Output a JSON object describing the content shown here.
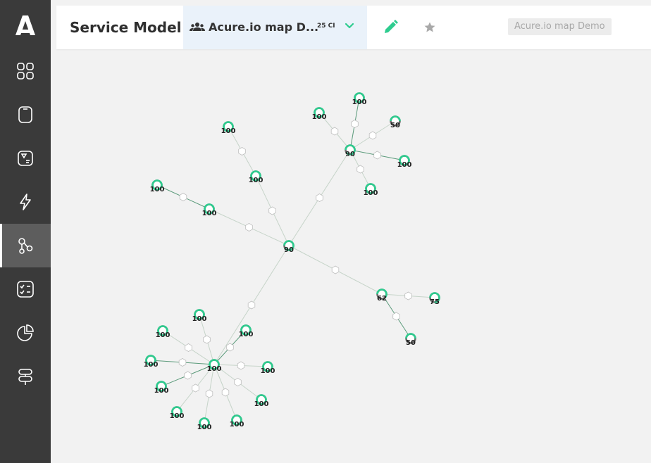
{
  "app": {
    "logo": "A",
    "accent": "#2ecc8f",
    "sidebar_bg": "#3a3a3a"
  },
  "sidebar": {
    "items": [
      {
        "icon": "dashboard-grid-icon",
        "active": false
      },
      {
        "icon": "tablet-icon",
        "active": false
      },
      {
        "icon": "notes-icon",
        "active": false
      },
      {
        "icon": "lightning-icon",
        "active": false
      },
      {
        "icon": "service-map-icon",
        "active": true
      },
      {
        "icon": "checklist-icon",
        "active": false
      },
      {
        "icon": "pie-chart-icon",
        "active": false
      },
      {
        "icon": "signpost-icon",
        "active": false
      }
    ]
  },
  "header": {
    "title": "Service Model",
    "map_selector": {
      "icon": "users-icon",
      "name": "Acure.io map D...",
      "ci_count": "25 CI"
    },
    "badge": "Acure.io map Demo"
  },
  "graph": {
    "nodes": [
      {
        "id": "root",
        "label": "90",
        "health": 90
      },
      {
        "id": "hub_tr",
        "label": "90",
        "health": 90
      },
      {
        "id": "tr1",
        "label": "100",
        "health": 100
      },
      {
        "id": "tr2",
        "label": "100",
        "health": 100
      },
      {
        "id": "tr3",
        "label": "50",
        "health": 50
      },
      {
        "id": "tr4",
        "label": "100",
        "health": 100
      },
      {
        "id": "tr5",
        "label": "100",
        "health": 100
      },
      {
        "id": "tl1",
        "label": "100",
        "health": 100
      },
      {
        "id": "tl2",
        "label": "100",
        "health": 100
      },
      {
        "id": "tl3",
        "label": "100",
        "health": 100
      },
      {
        "id": "tl4",
        "label": "100",
        "health": 100
      },
      {
        "id": "hub_br",
        "label": "62",
        "health": 62
      },
      {
        "id": "br1",
        "label": "75",
        "health": 75
      },
      {
        "id": "br2",
        "label": "50",
        "health": 50
      },
      {
        "id": "hub_bl",
        "label": "100",
        "health": 100
      },
      {
        "id": "bl1",
        "label": "100",
        "health": 100
      },
      {
        "id": "bl2",
        "label": "100",
        "health": 100
      },
      {
        "id": "bl3",
        "label": "100",
        "health": 100
      },
      {
        "id": "bl4",
        "label": "100",
        "health": 100
      },
      {
        "id": "bl5",
        "label": "100",
        "health": 100
      },
      {
        "id": "bl6",
        "label": "100",
        "health": 100
      },
      {
        "id": "bl7",
        "label": "100",
        "health": 100
      },
      {
        "id": "bl8",
        "label": "100",
        "health": 100
      },
      {
        "id": "bl9",
        "label": "100",
        "health": 100
      },
      {
        "id": "bl10",
        "label": "100",
        "health": 100
      }
    ],
    "edges": [
      [
        "root",
        "hub_tr"
      ],
      [
        "hub_tr",
        "tr1"
      ],
      [
        "hub_tr",
        "tr2"
      ],
      [
        "hub_tr",
        "tr3"
      ],
      [
        "hub_tr",
        "tr4"
      ],
      [
        "hub_tr",
        "tr5"
      ],
      [
        "root",
        "tl1"
      ],
      [
        "tl1",
        "tl2"
      ],
      [
        "root",
        "tl3"
      ],
      [
        "tl3",
        "tl4"
      ],
      [
        "root",
        "hub_br"
      ],
      [
        "hub_br",
        "br1"
      ],
      [
        "hub_br",
        "br2"
      ],
      [
        "root",
        "hub_bl"
      ],
      [
        "hub_bl",
        "bl1"
      ],
      [
        "hub_bl",
        "bl2"
      ],
      [
        "hub_bl",
        "bl3"
      ],
      [
        "hub_bl",
        "bl4"
      ],
      [
        "hub_bl",
        "bl5"
      ],
      [
        "hub_bl",
        "bl6"
      ],
      [
        "hub_bl",
        "bl7"
      ],
      [
        "hub_bl",
        "bl8"
      ],
      [
        "hub_bl",
        "bl9"
      ],
      [
        "hub_bl",
        "bl10"
      ]
    ],
    "colors": {
      "healthy": "#2ecc8f",
      "degraded": "#7a7a7a"
    }
  }
}
